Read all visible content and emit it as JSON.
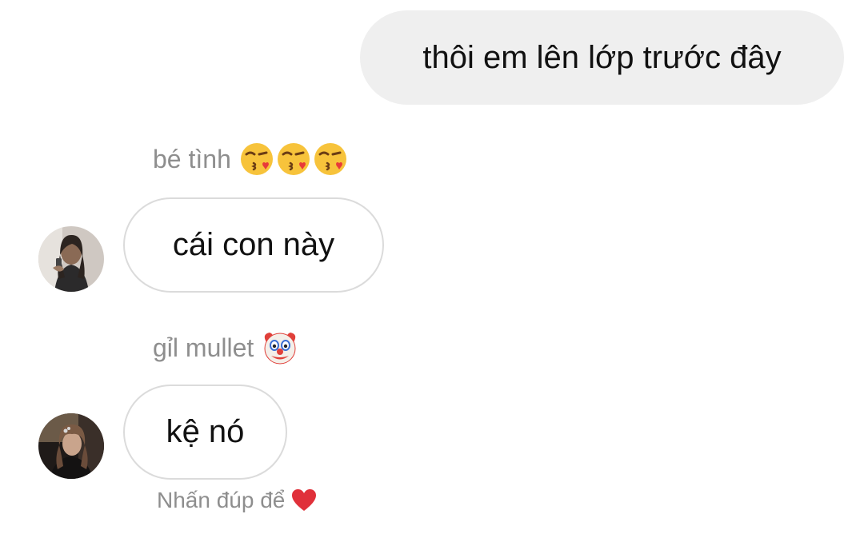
{
  "messages": {
    "outgoing_1": {
      "text": "thôi em lên lớp trước đây"
    },
    "incoming_1": {
      "sender_name": "bé tình",
      "sender_emoji": "face-blowing-kiss x3",
      "text": "cái con này"
    },
    "incoming_2": {
      "sender_name": "gỉl mullet",
      "sender_emoji": "clown-face",
      "text": "kệ nó"
    }
  },
  "hint": {
    "text": "Nhấn đúp để",
    "icon": "heart-icon"
  },
  "colors": {
    "outgoing_bubble": "#efefef",
    "incoming_border": "#dbdbdb",
    "secondary_text": "#8e8e8e",
    "heart": "#e0303a"
  }
}
